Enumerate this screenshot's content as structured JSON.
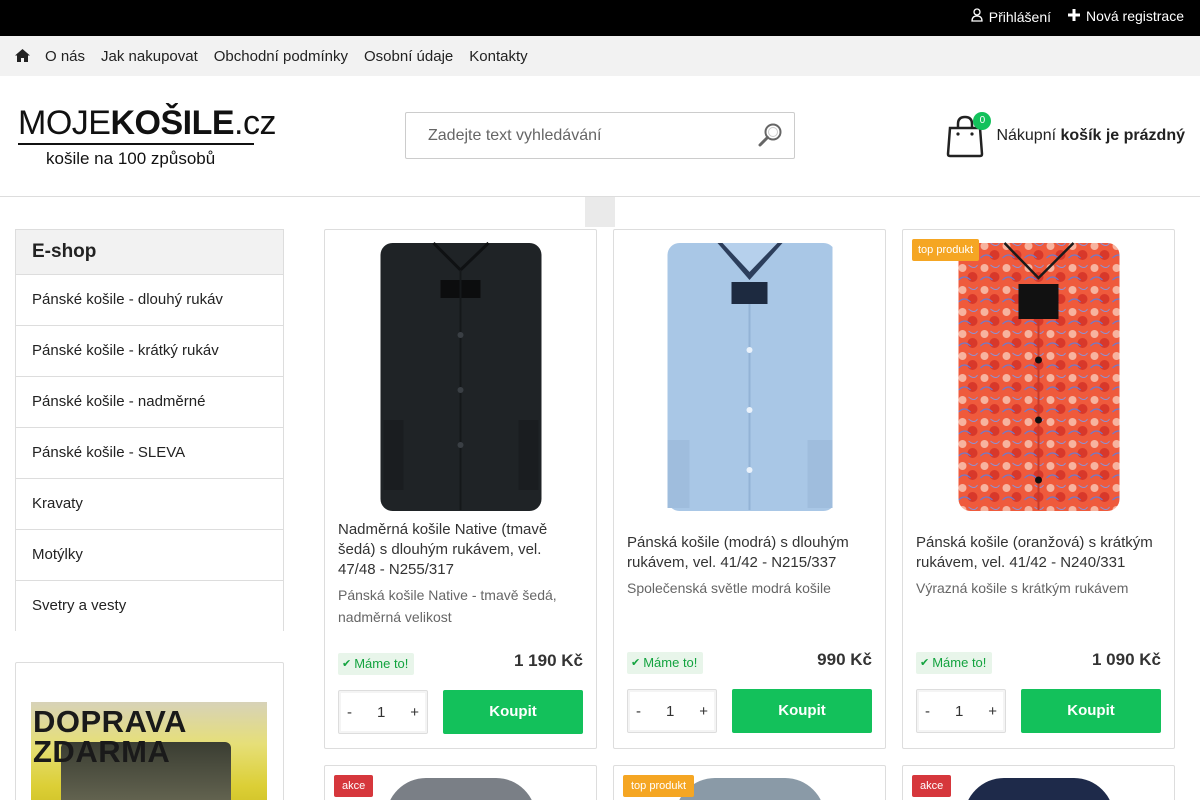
{
  "topbar": {
    "login": "Přihlášení",
    "register": "Nová registrace"
  },
  "nav": {
    "items": [
      "O nás",
      "Jak nakupovat",
      "Obchodní podmínky",
      "Osobní údaje",
      "Kontakty"
    ]
  },
  "logo": {
    "part1": "MOJE",
    "part2": "KOŠILE",
    "part3": ".cz",
    "tagline": "košile na 100 způsobů"
  },
  "search": {
    "placeholder": "Zadejte text vyhledávání"
  },
  "cart": {
    "count": "0",
    "label": "Nákupní",
    "status": "košík je prázdný"
  },
  "sidebar": {
    "title": "E-shop",
    "items": [
      "Pánské košile - dlouhý rukáv",
      "Pánské košile - krátký rukáv",
      "Pánské košile - nadměrné",
      "Pánské košile - SLEVA",
      "Kravaty",
      "Motýlky",
      "Svetry a vesty"
    ]
  },
  "banner": {
    "line1": "DOPRAVA",
    "line2": "ZDARMA"
  },
  "products": [
    {
      "badge": "",
      "title": "Nadměrná košile Native (tmavě šedá) s dlouhým rukávem, vel. 47/48 - N255/317",
      "desc": "Pánská košile Native - tmavě šedá, nadměrná velikost",
      "stock": "Máme to!",
      "price": "1 190 Kč",
      "qty": "1",
      "buy": "Koupit",
      "color": "#1f2326"
    },
    {
      "badge": "",
      "title": "Pánská košile (modrá) s dlouhým rukávem, vel. 41/42 - N215/337",
      "desc": "Společenská světle modrá košile",
      "stock": "Máme to!",
      "price": "990 Kč",
      "qty": "1",
      "buy": "Koupit",
      "color": "#a9c7e6"
    },
    {
      "badge": "top produkt",
      "title": "Pánská košile (oranžová) s krátkým rukávem, vel. 41/42 - N240/331",
      "desc": "Výrazná košile s krátkým rukávem",
      "stock": "Máme to!",
      "price": "1 090 Kč",
      "qty": "1",
      "buy": "Koupit",
      "color": "#e8553a"
    }
  ],
  "products_row2": [
    {
      "badge": "akce",
      "badge_color": "#d6373c",
      "color": "#7a7f86"
    },
    {
      "badge": "top produkt",
      "badge_color": "#f5a623",
      "color": "#8a9aa7"
    },
    {
      "badge": "akce",
      "badge_color": "#d6373c",
      "color": "#1e2a4a"
    }
  ],
  "qty_controls": {
    "minus": "-",
    "plus": "+"
  }
}
